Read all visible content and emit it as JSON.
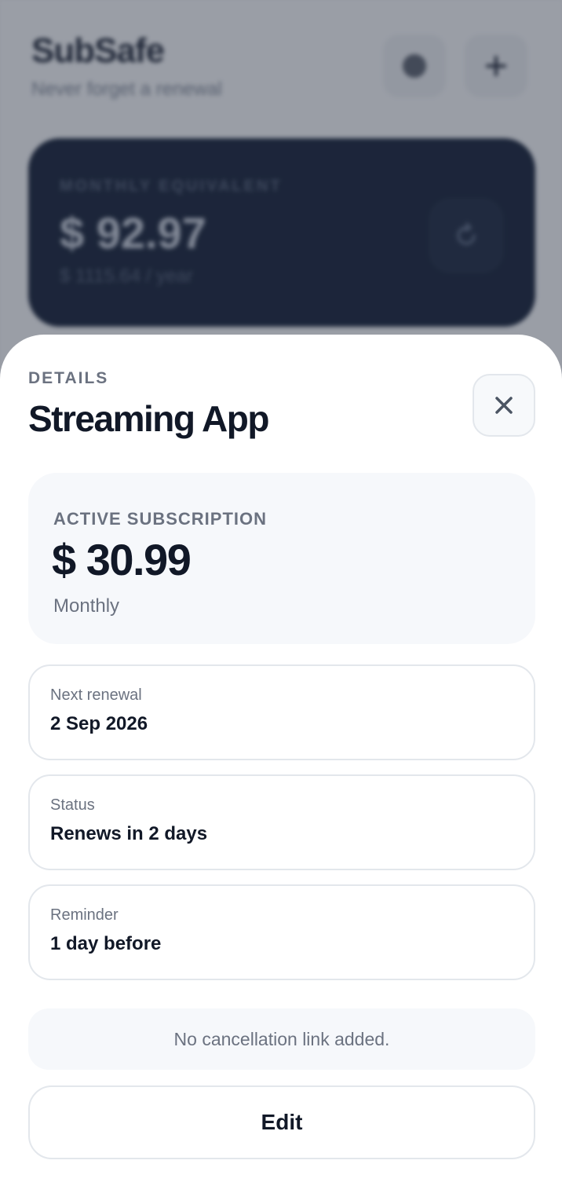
{
  "background": {
    "app_title": "SubSafe",
    "app_subtitle": "Never forget a renewal",
    "summary_card": {
      "label": "MONTHLY EQUIVALENT",
      "amount": "$ 92.97",
      "yearly": "$ 1115.64 / year"
    },
    "icons": [
      "settings-dot-icon",
      "plus-icon",
      "refresh-icon"
    ]
  },
  "sheet": {
    "eyebrow": "DETAILS",
    "title": "Streaming App",
    "close_icon": "close-icon",
    "summary": {
      "label": "ACTIVE SUBSCRIPTION",
      "amount": "$ 30.99",
      "cycle": "Monthly"
    },
    "details": [
      {
        "label": "Next renewal",
        "value": "2 Sep 2026"
      },
      {
        "label": "Status",
        "value": "Renews in 2 days"
      },
      {
        "label": "Reminder",
        "value": "1 day before"
      }
    ],
    "notice": "No cancellation link added.",
    "edit_label": "Edit"
  },
  "colors": {
    "text_primary": "#111827",
    "text_muted": "#6b7280",
    "card_dark": "#0f1b33",
    "border": "#e3e7ec",
    "soft_surface": "#f6f8fb"
  }
}
